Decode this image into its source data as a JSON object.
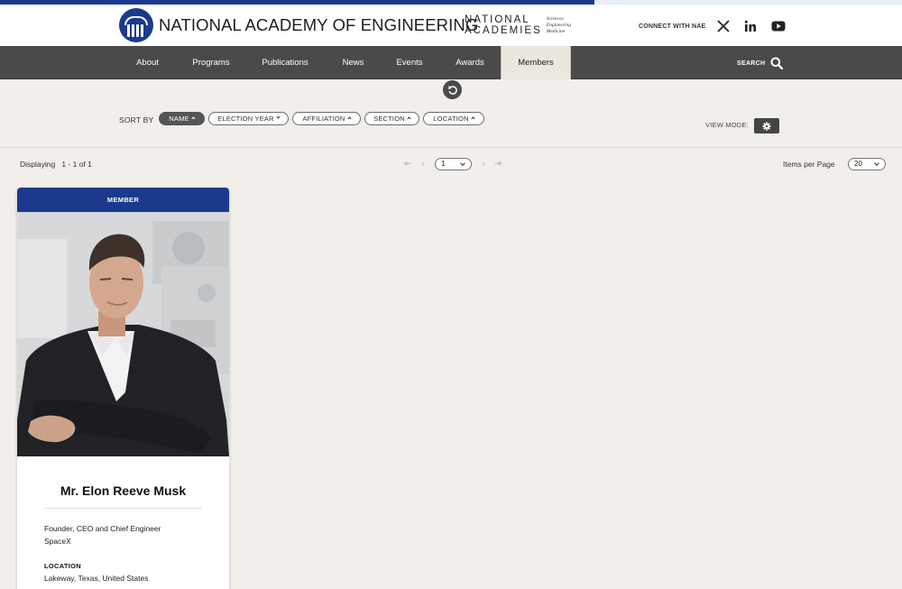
{
  "header": {
    "logo_text": "NATIONAL ACADEMY OF ENGINEERING",
    "partner_line1": "NATIONAL",
    "partner_line2": "ACADEMIES",
    "partner_sub1": "Sciences",
    "partner_sub2": "Engineering",
    "partner_sub3": "Medicine",
    "connect_label": "CONNECT WITH NAE",
    "social_icons": [
      "x-icon",
      "linkedin-icon",
      "youtube-icon"
    ]
  },
  "nav": {
    "items": [
      {
        "label": "About"
      },
      {
        "label": "Programs"
      },
      {
        "label": "Publications"
      },
      {
        "label": "News"
      },
      {
        "label": "Events"
      },
      {
        "label": "Awards"
      },
      {
        "label": "Members"
      }
    ],
    "active": "Members",
    "search_label": "SEARCH"
  },
  "sort": {
    "label": "SORT BY",
    "options": [
      "NAME",
      "ELECTION YEAR",
      "AFFILIATION",
      "SECTION",
      "LOCATION"
    ],
    "active": "NAME",
    "view_mode_label": "VIEW MODE:"
  },
  "pagination": {
    "displaying_label": "Displaying",
    "range": "1 - 1 of 1",
    "current_page": "1",
    "items_per_page_label": "Items per Page",
    "items_per_page": "20"
  },
  "member_card": {
    "badge": "MEMBER",
    "name": "Mr. Elon Reeve Musk",
    "title": "Founder, CEO and Chief Engineer",
    "organization": "SpaceX",
    "location_label": "LOCATION",
    "location": "Lakeway, Texas, United States"
  },
  "colors": {
    "brand_blue": "#1b3a8c",
    "nav_bg": "#4a4a4a",
    "page_bg": "#f2efea",
    "nav_active_bg": "#ebe6de"
  }
}
